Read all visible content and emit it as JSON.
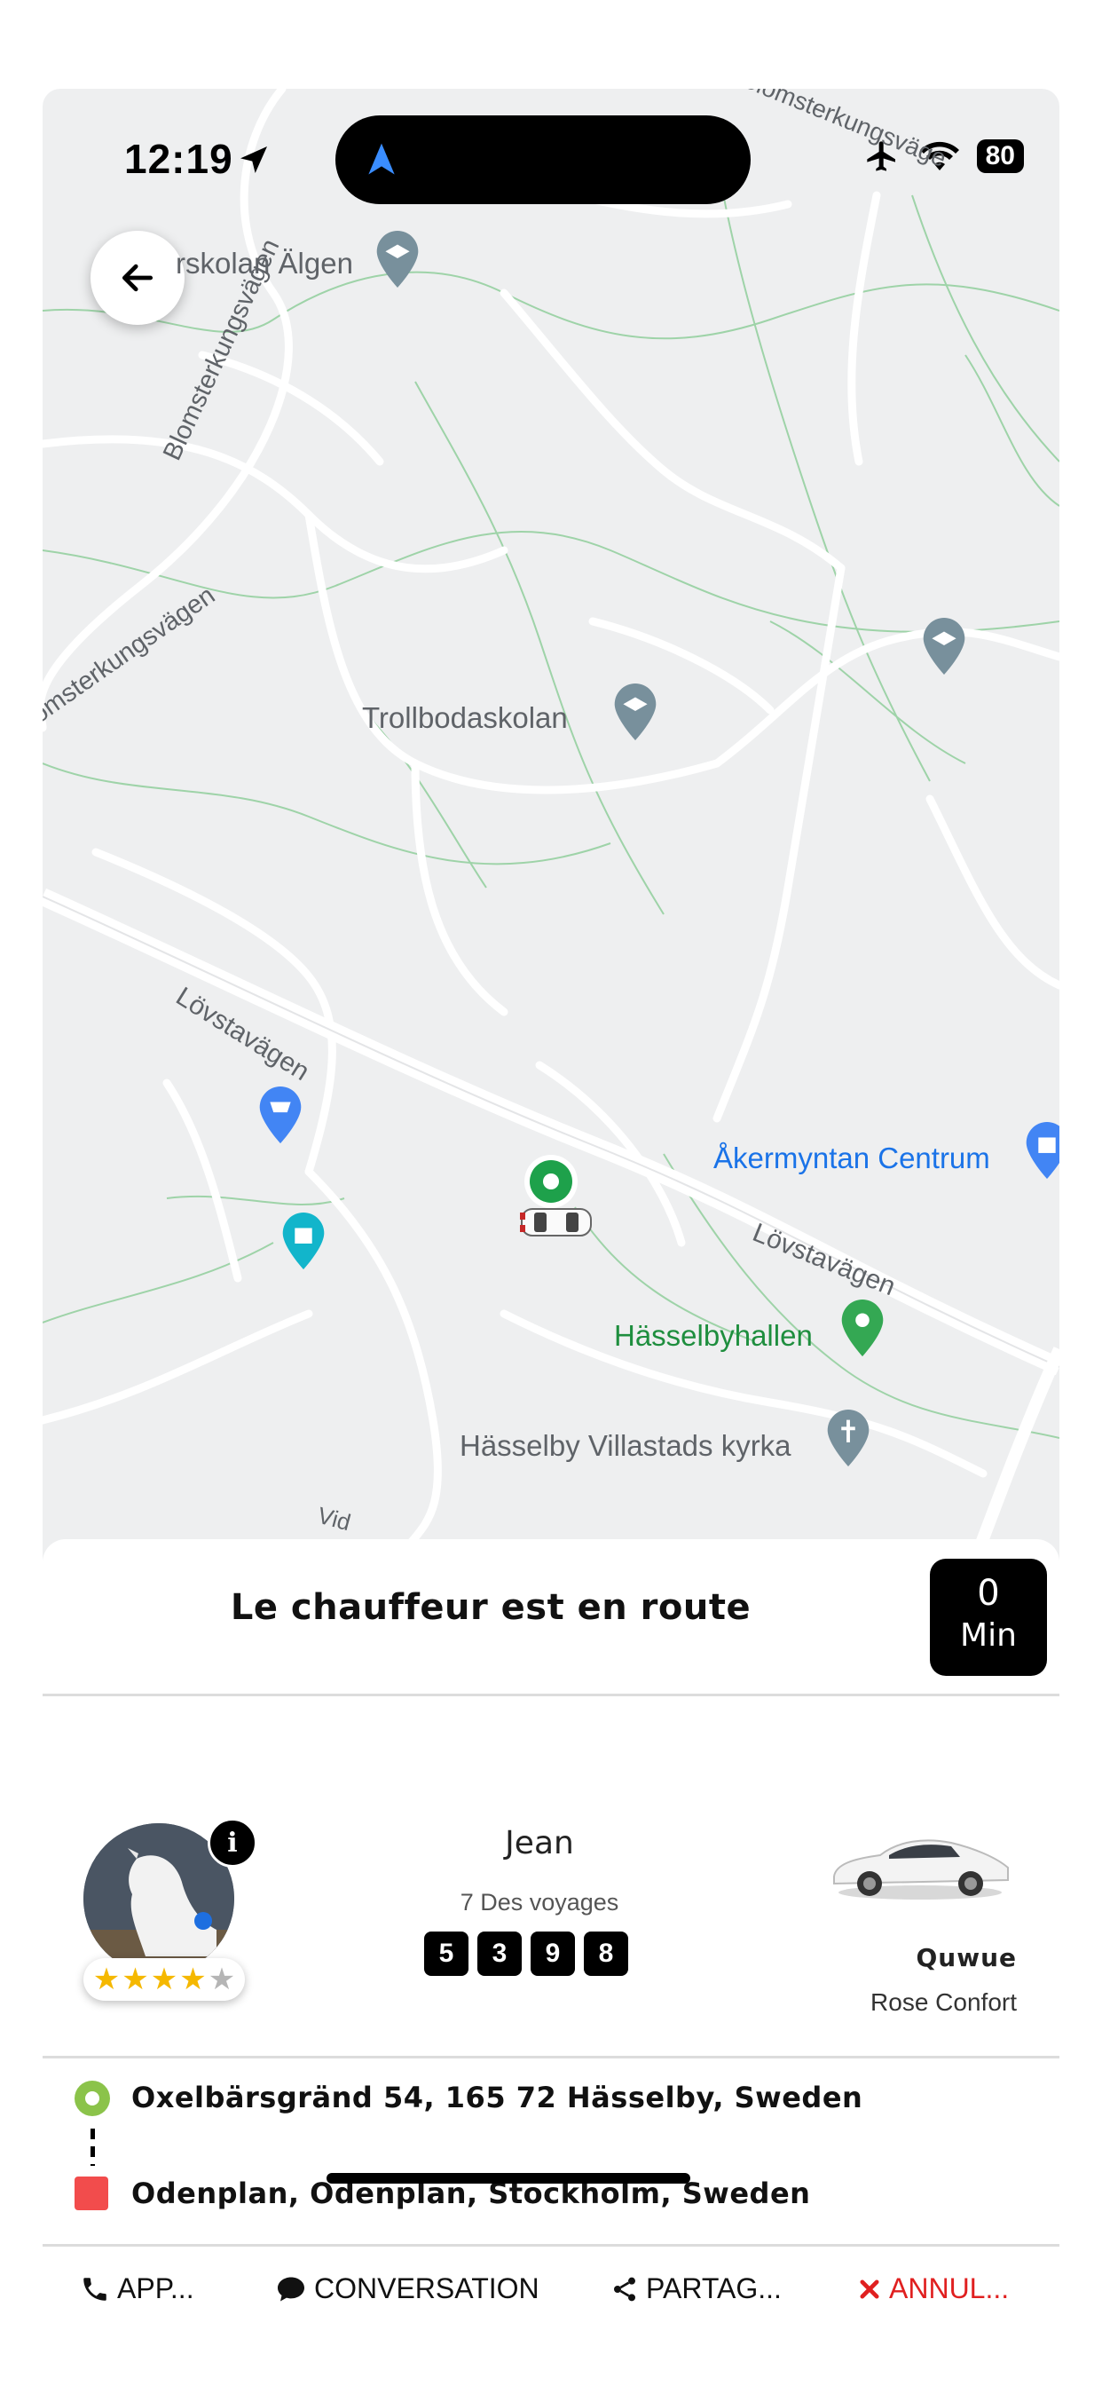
{
  "status_bar": {
    "time": "12:19",
    "battery": "80"
  },
  "map": {
    "labels": {
      "school_algen": "rskolan Älgen",
      "road_blomsterkungsvagen_1": "Blomsterkungsvägen",
      "road_blomsterkungsvagen_2": "Blomsterkungsvägen",
      "road_blomster_top": "Blomsterkungsväge",
      "trollbodaskolan": "Trollbodaskolan",
      "lovstavagen_1": "Lövstavägen",
      "lovstavagen_2": "Lövstavägen",
      "akermyntan": "Åkermyntan Centrum",
      "hasselbyhallen": "Hässelbyhallen",
      "kyrka": "Hässelby Villastads kyrka",
      "vid": "Vid"
    }
  },
  "ride_status": {
    "title": "Le chauffeur est en route",
    "eta_value": "0",
    "eta_unit": "Min"
  },
  "driver": {
    "name": "Jean",
    "trips": "7 Des voyages",
    "plate": [
      "5",
      "3",
      "9",
      "8"
    ],
    "rating_stars": 4,
    "rating_max": 5,
    "info_icon": "i"
  },
  "vehicle": {
    "name": "Quwue",
    "class": "Rose Confort"
  },
  "route": {
    "pickup": "Oxelbärsgränd 54, 165 72 Hässelby, Sweden",
    "dropoff": "Odenplan, Odenplan, Stockholm, Sweden"
  },
  "actions": {
    "call": "APP...",
    "chat": "CONVERSATION",
    "share": "PARTAG...",
    "cancel": "ANNUL..."
  },
  "colors": {
    "pickup_green": "#8bc34a",
    "dropoff_red": "#f24c4c",
    "cancel_red": "#e02020",
    "map_bg": "#eeeff0"
  }
}
